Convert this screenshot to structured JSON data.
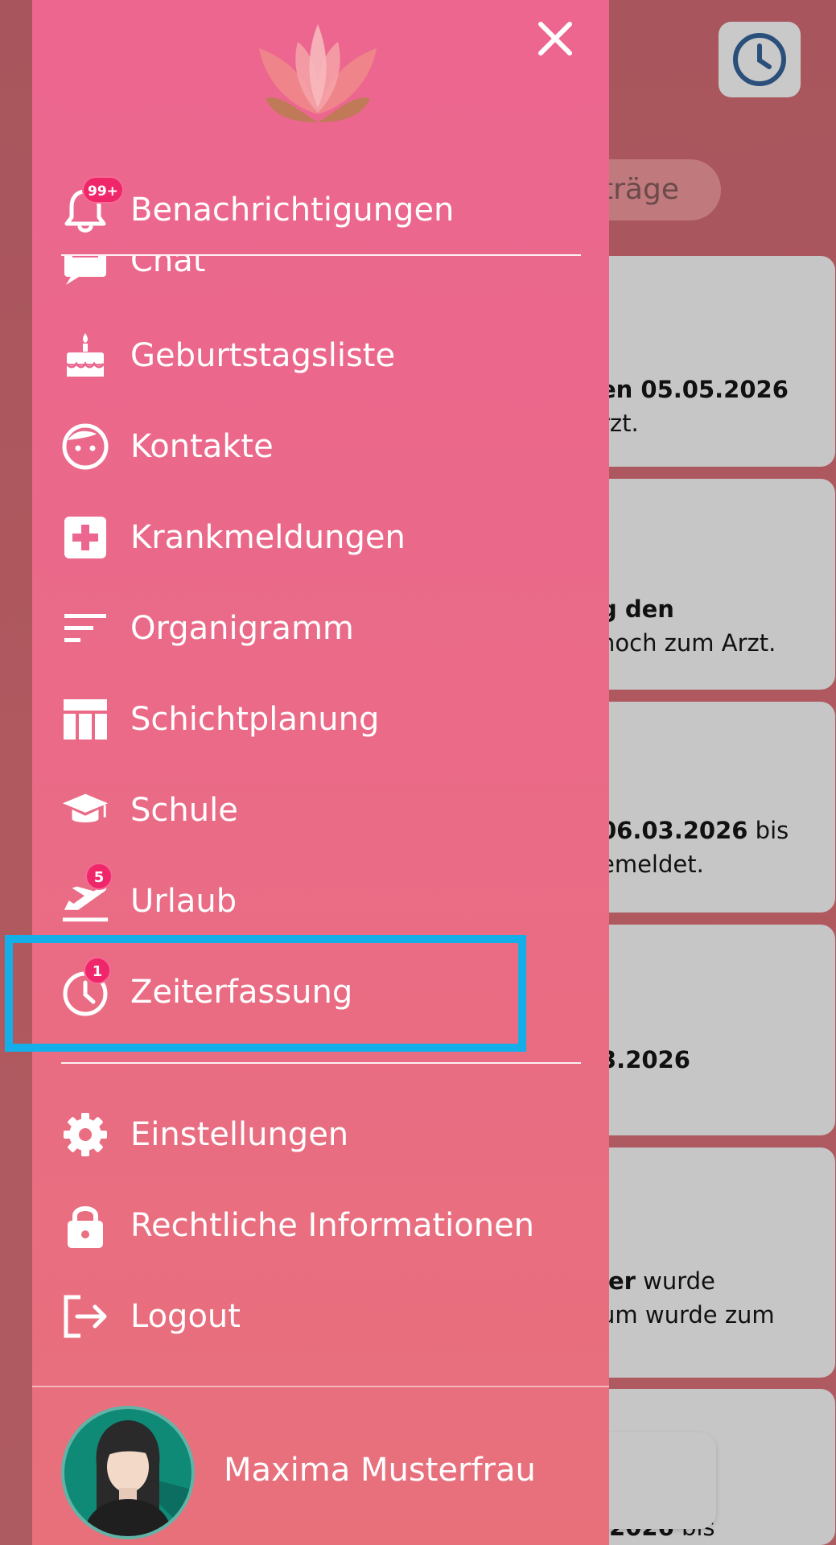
{
  "background": {
    "chip_label": "träge",
    "cards": [
      {
        "bold": "en 05.05.2026",
        "text": "rzt."
      },
      {
        "bold": "g den",
        "text": "noch zum Arzt."
      },
      {
        "bold": "06.03.2026",
        "bold_tail": " bis",
        "text": "emeldet."
      },
      {
        "bold": "3.2026",
        "text": ""
      },
      {
        "bold": "ler",
        "bold_tail": " wurde",
        "text": "um wurde zum"
      },
      {
        "bold": ".2026",
        "bold_tail": " bis",
        "text": ""
      }
    ]
  },
  "drawer": {
    "close_icon": "close-icon",
    "items": [
      {
        "id": "benachrichtigungen",
        "label": "Benachrichtigungen",
        "icon": "bell-icon",
        "badge": "99+"
      },
      {
        "id": "chat",
        "label": "Chat",
        "icon": "chat-icon"
      },
      {
        "id": "geburtstagsliste",
        "label": "Geburtstagsliste",
        "icon": "cake-icon"
      },
      {
        "id": "kontakte",
        "label": "Kontakte",
        "icon": "face-icon"
      },
      {
        "id": "krankmeldungen",
        "label": "Krankmeldungen",
        "icon": "medical-cross-icon"
      },
      {
        "id": "organigramm",
        "label": "Organigramm",
        "icon": "sort-lines-icon"
      },
      {
        "id": "schichtplanung",
        "label": "Schichtplanung",
        "icon": "table-icon"
      },
      {
        "id": "schule",
        "label": "Schule",
        "icon": "graduation-cap-icon"
      },
      {
        "id": "urlaub",
        "label": "Urlaub",
        "icon": "airplane-takeoff-icon",
        "badge": "5"
      },
      {
        "id": "zeiterfassung",
        "label": "Zeiterfassung",
        "icon": "clock-icon",
        "badge": "1"
      },
      {
        "id": "einstellungen",
        "label": "Einstellungen",
        "icon": "gear-icon"
      },
      {
        "id": "rechtliche-informationen",
        "label": "Rechtliche Informationen",
        "icon": "lock-icon"
      },
      {
        "id": "logout",
        "label": "Logout",
        "icon": "logout-icon"
      }
    ]
  },
  "user": {
    "name": "Maxima Musterfrau"
  },
  "colors": {
    "drawer_top": "#ec6690",
    "drawer_bottom": "#e8707b",
    "badge": "#f0266b",
    "highlight": "#14aee8"
  }
}
